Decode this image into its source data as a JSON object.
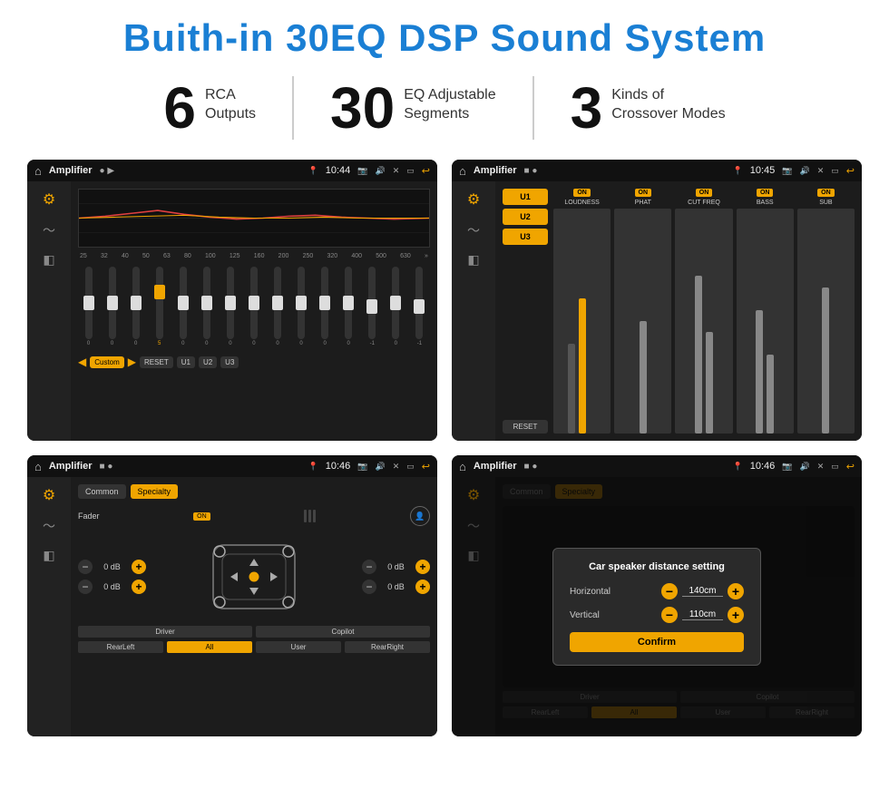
{
  "page": {
    "title": "Buith-in 30EQ DSP Sound System",
    "stats": [
      {
        "number": "6",
        "label": "RCA\nOutputs"
      },
      {
        "number": "30",
        "label": "EQ Adjustable\nSegments"
      },
      {
        "number": "3",
        "label": "Kinds of\nCrossover Modes"
      }
    ]
  },
  "screens": {
    "screen1": {
      "title": "Amplifier",
      "time": "10:44",
      "eq_bands": [
        "25",
        "32",
        "40",
        "50",
        "63",
        "80",
        "100",
        "125",
        "160",
        "200",
        "250",
        "320",
        "400",
        "500",
        "630"
      ],
      "eq_values": [
        "0",
        "0",
        "0",
        "5",
        "0",
        "0",
        "0",
        "0",
        "0",
        "0",
        "0",
        "0",
        "-1",
        "0",
        "-1"
      ],
      "bottom_btns": [
        "Custom",
        "RESET",
        "U1",
        "U2",
        "U3"
      ]
    },
    "screen2": {
      "title": "Amplifier",
      "time": "10:45",
      "channels": [
        "LOUDNESS",
        "PHAT",
        "CUT FREQ",
        "BASS",
        "SUB"
      ],
      "u_btns": [
        "U1",
        "U2",
        "U3"
      ],
      "reset_btn": "RESET"
    },
    "screen3": {
      "title": "Amplifier",
      "time": "10:46",
      "tabs": [
        "Common",
        "Specialty"
      ],
      "fader_label": "Fader",
      "on_label": "ON",
      "volume_rows": [
        {
          "value": "0 dB"
        },
        {
          "value": "0 dB"
        },
        {
          "value": "0 dB"
        },
        {
          "value": "0 dB"
        }
      ],
      "bottom_btns": [
        "Driver",
        "Copilot",
        "RearLeft",
        "All",
        "User",
        "RearRight"
      ]
    },
    "screen4": {
      "title": "Amplifier",
      "time": "10:46",
      "tabs": [
        "Common",
        "Specialty"
      ],
      "dialog": {
        "title": "Car speaker distance setting",
        "rows": [
          {
            "label": "Horizontal",
            "value": "140cm"
          },
          {
            "label": "Vertical",
            "value": "110cm"
          }
        ],
        "confirm_label": "Confirm"
      },
      "bottom_btns": [
        "Driver",
        "Copilot",
        "RearLeft",
        "All",
        "User",
        "RearRight"
      ]
    }
  },
  "colors": {
    "accent": "#1a7fd4",
    "yellow": "#f0a500",
    "dark_bg": "#1a1a1a",
    "text_dark": "#111111"
  }
}
